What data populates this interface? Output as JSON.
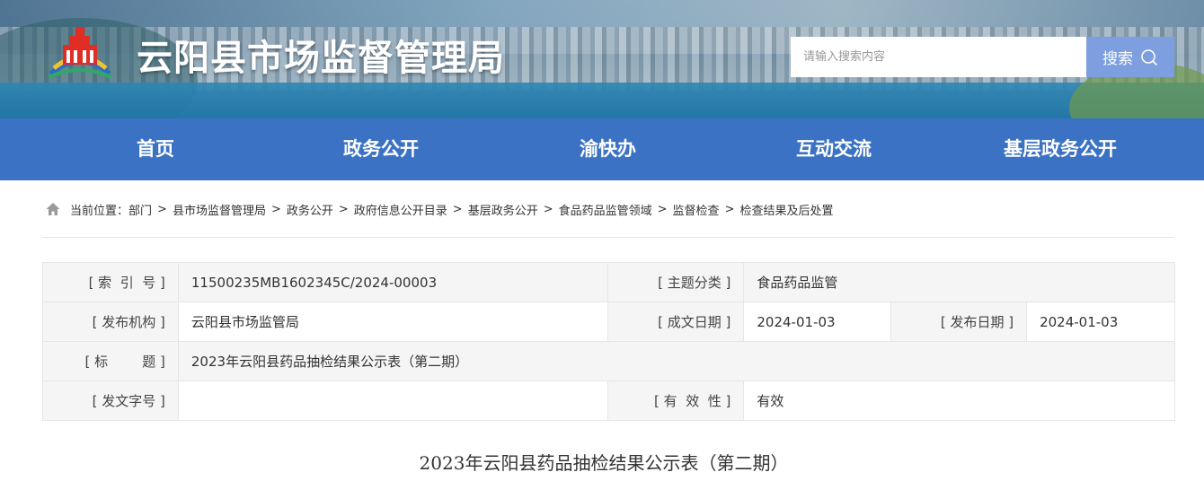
{
  "header": {
    "site_title": "云阳县市场监督管理局",
    "logo_icon": "government-emblem-icon",
    "search_placeholder": "请输入搜索内容",
    "search_button": "搜索",
    "search_icon": "search-icon",
    "nav_color": "#3b72c4",
    "search_button_color": "#7d9fe0"
  },
  "nav": {
    "items": [
      {
        "label": "首页"
      },
      {
        "label": "政务公开"
      },
      {
        "label": "渝快办"
      },
      {
        "label": "互动交流"
      },
      {
        "label": "基层政务公开"
      }
    ]
  },
  "breadcrumb": {
    "home_icon": "home-icon",
    "prefix": "当前位置：",
    "items": [
      "部门",
      "县市场监督管理局",
      "政务公开",
      "政府信息公开目录",
      "基层政务公开",
      "食品药品监管领域",
      "监督检查",
      "检查结果及后处置"
    ],
    "separator": ">"
  },
  "info": {
    "index_label": "[ 索  引  号 ]",
    "index_value": "11500235MB1602345C/2024-00003",
    "topic_label": "[ 主题分类 ]",
    "topic_value": "食品药品监管",
    "publisher_label": "[ 发布机构 ]",
    "publisher_value": "云阳县市场监管局",
    "written_label": "[ 成文日期 ]",
    "written_value": "2024-01-03",
    "published_label": "[ 发布日期 ]",
    "published_value": "2024-01-03",
    "title_label": "[ 标        题 ]",
    "title_value": "2023年云阳县药品抽检结果公示表（第二期）",
    "docno_label": "[ 发文字号 ]",
    "docno_value": "",
    "validity_label": "[ 有  效  性 ]",
    "validity_value": "有效"
  },
  "document": {
    "title": "2023年云阳县药品抽检结果公示表（第二期）"
  }
}
